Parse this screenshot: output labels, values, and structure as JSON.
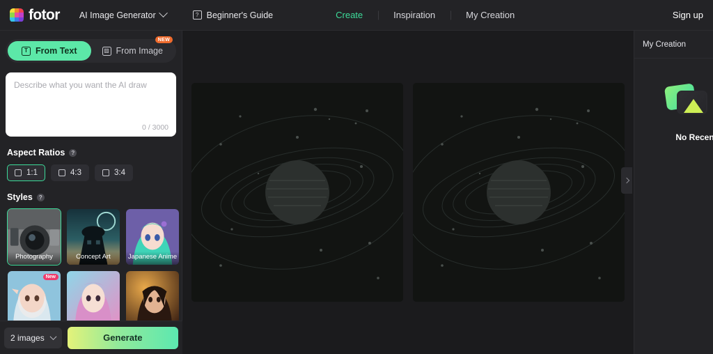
{
  "brand": {
    "name": "fotor",
    "logo_icon": "fotor-rainbow-logo"
  },
  "topbar": {
    "product_dropdown": {
      "label": "AI Image Generator",
      "icon": "chevron-down-icon"
    },
    "guide": {
      "label": "Beginner's Guide",
      "icon": "book-question-icon"
    },
    "nav": [
      {
        "label": "Create",
        "active": true
      },
      {
        "label": "Inspiration",
        "active": false
      },
      {
        "label": "My Creation",
        "active": false
      }
    ],
    "signup_label": "Sign up",
    "accent_color": "#3ddc9a"
  },
  "sidebar": {
    "tabs": [
      {
        "label": "From Text",
        "icon": "text-box-icon",
        "active": true,
        "badge": ""
      },
      {
        "label": "From Image",
        "icon": "image-icon",
        "active": false,
        "badge": "NEW"
      }
    ],
    "prompt": {
      "placeholder": "Describe what you want the AI draw",
      "value": "",
      "counter": "0 / 3000"
    },
    "aspect_ratios": {
      "title": "Aspect Ratios",
      "help_icon": "question-icon",
      "options": [
        {
          "label": "1:1",
          "selected": true
        },
        {
          "label": "4:3",
          "selected": false
        },
        {
          "label": "3:4",
          "selected": false
        }
      ]
    },
    "styles": {
      "title": "Styles",
      "help_icon": "question-icon",
      "items": [
        {
          "label": "Photography",
          "selected": true,
          "badge": ""
        },
        {
          "label": "Concept Art",
          "selected": false,
          "badge": ""
        },
        {
          "label": "Japanese Anime",
          "selected": false,
          "badge": ""
        },
        {
          "label": "",
          "selected": false,
          "badge": "New"
        },
        {
          "label": "",
          "selected": false,
          "badge": ""
        },
        {
          "label": "",
          "selected": false,
          "badge": ""
        }
      ]
    },
    "footer": {
      "image_count": {
        "label": "2 images",
        "icon": "chevron-down-icon"
      },
      "generate_label": "Generate",
      "generate_gradient": [
        "#e4f27a",
        "#5ce8b0"
      ]
    }
  },
  "canvas": {
    "previews": [
      {
        "alt": "planet-with-rings-placeholder"
      },
      {
        "alt": "planet-with-rings-placeholder"
      }
    ],
    "collapse_icon": "chevron-right-icon",
    "background_color": "#1b1b1d"
  },
  "right_panel": {
    "title": "My Creation",
    "empty_state": {
      "icon": "stacked-images-icon",
      "text": "No Recent"
    }
  }
}
